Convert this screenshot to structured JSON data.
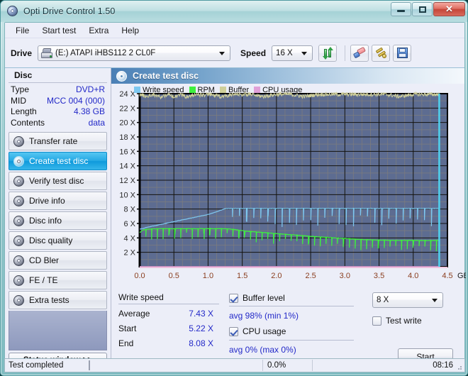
{
  "window": {
    "title": "Opti Drive Control 1.50",
    "icon": "disc-icon",
    "buttons": {
      "minimize": "minimize-icon",
      "maximize": "maximize-icon",
      "close": "✕"
    }
  },
  "menubar": {
    "items": [
      "File",
      "Start test",
      "Extra",
      "Help"
    ]
  },
  "toolbar": {
    "drive_label": "Drive",
    "drive_value": "(E:)   ATAPI iHBS112  2 CL0F",
    "speed_label": "Speed",
    "speed_value": "16 X",
    "buttons": [
      {
        "name": "refresh-button",
        "icon": "refresh-icon"
      },
      {
        "name": "erase-button",
        "icon": "eraser-icon"
      },
      {
        "name": "tools-button",
        "icon": "wrench-icon"
      },
      {
        "name": "save-button",
        "icon": "floppy-save-icon"
      }
    ]
  },
  "sidebar": {
    "section_title": "Disc",
    "disc_info": [
      {
        "key": "Type",
        "value": "DVD+R"
      },
      {
        "key": "MID",
        "value": "MCC 004 (000)"
      },
      {
        "key": "Length",
        "value": "4.38 GB"
      },
      {
        "key": "Contents",
        "value": "data"
      }
    ],
    "nav_items": [
      {
        "label": "Transfer rate",
        "active": false
      },
      {
        "label": "Create test disc",
        "active": true
      },
      {
        "label": "Verify test disc",
        "active": false
      },
      {
        "label": "Drive info",
        "active": false
      },
      {
        "label": "Disc info",
        "active": false
      },
      {
        "label": "Disc quality",
        "active": false
      },
      {
        "label": "CD Bler",
        "active": false
      },
      {
        "label": "FE / TE",
        "active": false
      },
      {
        "label": "Extra tests",
        "active": false
      }
    ],
    "status_window_button": "Status window >>"
  },
  "panel": {
    "title": "Create test disc",
    "icon": "disc-icon"
  },
  "chart_data": {
    "type": "line",
    "title": "Create test disc",
    "xlabel": "GB",
    "ylabel": "",
    "xlim": [
      0,
      4.5
    ],
    "ylim": [
      0,
      24
    ],
    "x_ticks": [
      0.0,
      0.5,
      1.0,
      1.5,
      2.0,
      2.5,
      3.0,
      3.5,
      4.0,
      4.5
    ],
    "x_tick_labels": [
      "0.0",
      "0.5",
      "1.0",
      "1.5",
      "2.0",
      "2.5",
      "3.0",
      "3.5",
      "4.0",
      "4.5"
    ],
    "x_axis_unit": "GB",
    "y_ticks": [
      2,
      4,
      6,
      8,
      10,
      12,
      14,
      16,
      18,
      20,
      22,
      24
    ],
    "y_tick_labels": [
      "2 X",
      "4 X",
      "6 X",
      "8 X",
      "10 X",
      "12 X",
      "14 X",
      "16 X",
      "18 X",
      "20 X",
      "22 X",
      "24 X"
    ],
    "grid": true,
    "legend_position": "top-left",
    "plot_bg": "#5d6c91",
    "legend": [
      {
        "name": "Write speed",
        "color": "#7ec8f0"
      },
      {
        "name": "RPM",
        "color": "#3ef03e"
      },
      {
        "name": "Buffer",
        "color": "#cfcf9a"
      },
      {
        "name": "CPU usage",
        "color": "#e0a0d8"
      }
    ],
    "series": [
      {
        "name": "Write speed",
        "color": "#7ec8f0",
        "points": [
          [
            0.0,
            5.22
          ],
          [
            0.05,
            5.3
          ],
          [
            0.1,
            5.45
          ],
          [
            0.15,
            5.55
          ],
          [
            0.2,
            5.65
          ],
          [
            0.25,
            5.75
          ],
          [
            0.3,
            5.85
          ],
          [
            0.35,
            5.95
          ],
          [
            0.4,
            6.05
          ],
          [
            0.45,
            6.15
          ],
          [
            0.5,
            6.25
          ],
          [
            0.55,
            6.35
          ],
          [
            0.6,
            6.45
          ],
          [
            0.65,
            6.55
          ],
          [
            0.7,
            6.65
          ],
          [
            0.75,
            6.75
          ],
          [
            0.8,
            6.85
          ],
          [
            0.85,
            6.95
          ],
          [
            0.9,
            7.05
          ],
          [
            0.95,
            7.15
          ],
          [
            1.0,
            7.25
          ],
          [
            1.05,
            7.4
          ],
          [
            1.1,
            7.55
          ],
          [
            1.15,
            7.7
          ],
          [
            1.2,
            7.9
          ],
          [
            1.25,
            8.05
          ],
          [
            1.3,
            8.08
          ],
          [
            1.4,
            8.08
          ],
          [
            1.6,
            8.08
          ],
          [
            1.8,
            8.08
          ],
          [
            2.0,
            8.08
          ],
          [
            2.2,
            8.08
          ],
          [
            2.4,
            8.08
          ],
          [
            2.6,
            8.08
          ],
          [
            2.8,
            8.08
          ],
          [
            3.0,
            8.08
          ],
          [
            3.2,
            8.08
          ],
          [
            3.4,
            8.08
          ],
          [
            3.6,
            8.08
          ],
          [
            3.8,
            8.08
          ],
          [
            4.0,
            8.08
          ],
          [
            4.2,
            8.08
          ],
          [
            4.38,
            8.08
          ]
        ]
      },
      {
        "name": "RPM",
        "color": "#3ef03e",
        "points": [
          [
            0.0,
            4.75
          ],
          [
            0.05,
            5.1
          ],
          [
            0.1,
            5.2
          ],
          [
            0.2,
            5.25
          ],
          [
            0.3,
            5.28
          ],
          [
            0.4,
            5.28
          ],
          [
            0.5,
            5.28
          ],
          [
            0.6,
            5.28
          ],
          [
            0.7,
            5.28
          ],
          [
            0.8,
            5.28
          ],
          [
            0.9,
            5.28
          ],
          [
            1.0,
            5.28
          ],
          [
            1.1,
            5.28
          ],
          [
            1.2,
            5.28
          ],
          [
            1.3,
            5.25
          ],
          [
            1.4,
            5.15
          ],
          [
            1.5,
            5.0
          ],
          [
            1.6,
            4.9
          ],
          [
            1.7,
            4.82
          ],
          [
            1.8,
            4.75
          ],
          [
            1.9,
            4.68
          ],
          [
            2.0,
            4.6
          ],
          [
            2.1,
            4.52
          ],
          [
            2.2,
            4.45
          ],
          [
            2.3,
            4.38
          ],
          [
            2.4,
            4.3
          ],
          [
            2.5,
            4.22
          ],
          [
            2.6,
            4.16
          ],
          [
            2.7,
            4.1
          ],
          [
            2.8,
            4.04
          ],
          [
            2.9,
            3.98
          ],
          [
            3.0,
            3.92
          ],
          [
            3.1,
            3.86
          ],
          [
            3.2,
            3.8
          ],
          [
            3.3,
            3.76
          ],
          [
            3.4,
            3.72
          ],
          [
            3.5,
            3.7
          ],
          [
            3.6,
            3.68
          ],
          [
            3.7,
            3.66
          ],
          [
            3.8,
            3.66
          ],
          [
            3.9,
            3.66
          ],
          [
            4.0,
            3.66
          ],
          [
            4.1,
            3.64
          ],
          [
            4.2,
            3.64
          ],
          [
            4.38,
            3.66
          ]
        ]
      },
      {
        "name": "Buffer",
        "color": "#cfcf9a",
        "points": [
          [
            0.0,
            23.9
          ],
          [
            0.1,
            23.6
          ],
          [
            0.2,
            23.9
          ],
          [
            0.3,
            23.5
          ],
          [
            0.4,
            23.9
          ],
          [
            0.5,
            23.6
          ],
          [
            0.6,
            23.9
          ],
          [
            0.7,
            23.5
          ],
          [
            0.8,
            23.9
          ],
          [
            0.9,
            23.8
          ],
          [
            1.0,
            23.9
          ],
          [
            1.2,
            23.6
          ],
          [
            1.4,
            23.9
          ],
          [
            1.6,
            23.9
          ],
          [
            1.8,
            23.6
          ],
          [
            2.0,
            23.9
          ],
          [
            2.2,
            23.9
          ],
          [
            2.4,
            23.6
          ],
          [
            2.6,
            23.9
          ],
          [
            2.8,
            23.9
          ],
          [
            3.0,
            23.9
          ],
          [
            3.2,
            23.9
          ],
          [
            3.4,
            23.9
          ],
          [
            3.6,
            23.9
          ],
          [
            3.8,
            23.6
          ],
          [
            4.0,
            23.9
          ],
          [
            4.2,
            23.9
          ],
          [
            4.38,
            23.9
          ]
        ]
      },
      {
        "name": "CPU usage",
        "color": "#e0a0d8",
        "points": [
          [
            0.0,
            0.0
          ],
          [
            4.38,
            0.0
          ]
        ]
      }
    ],
    "end_marker_x": 4.38,
    "end_marker_color": "#4fd2ee"
  },
  "stats": {
    "write_speed_title": "Write speed",
    "rows": [
      {
        "key": "Average",
        "value": "7.43 X"
      },
      {
        "key": "Start",
        "value": "5.22 X"
      },
      {
        "key": "End",
        "value": "8.08 X"
      }
    ],
    "buffer_level_label": "Buffer level",
    "buffer_level_checked": true,
    "buffer_level_value": "avg 98% (min 1%)",
    "cpu_usage_label": "CPU usage",
    "cpu_usage_checked": true,
    "cpu_usage_value": "avg 0% (max 0%)",
    "write_speed_select": "8 X",
    "test_write_label": "Test write",
    "test_write_checked": false,
    "start_button": "Start"
  },
  "statusbar": {
    "text": "Test completed",
    "progress_percent": "0.0%",
    "progress_value": 0,
    "time": "08:16"
  }
}
